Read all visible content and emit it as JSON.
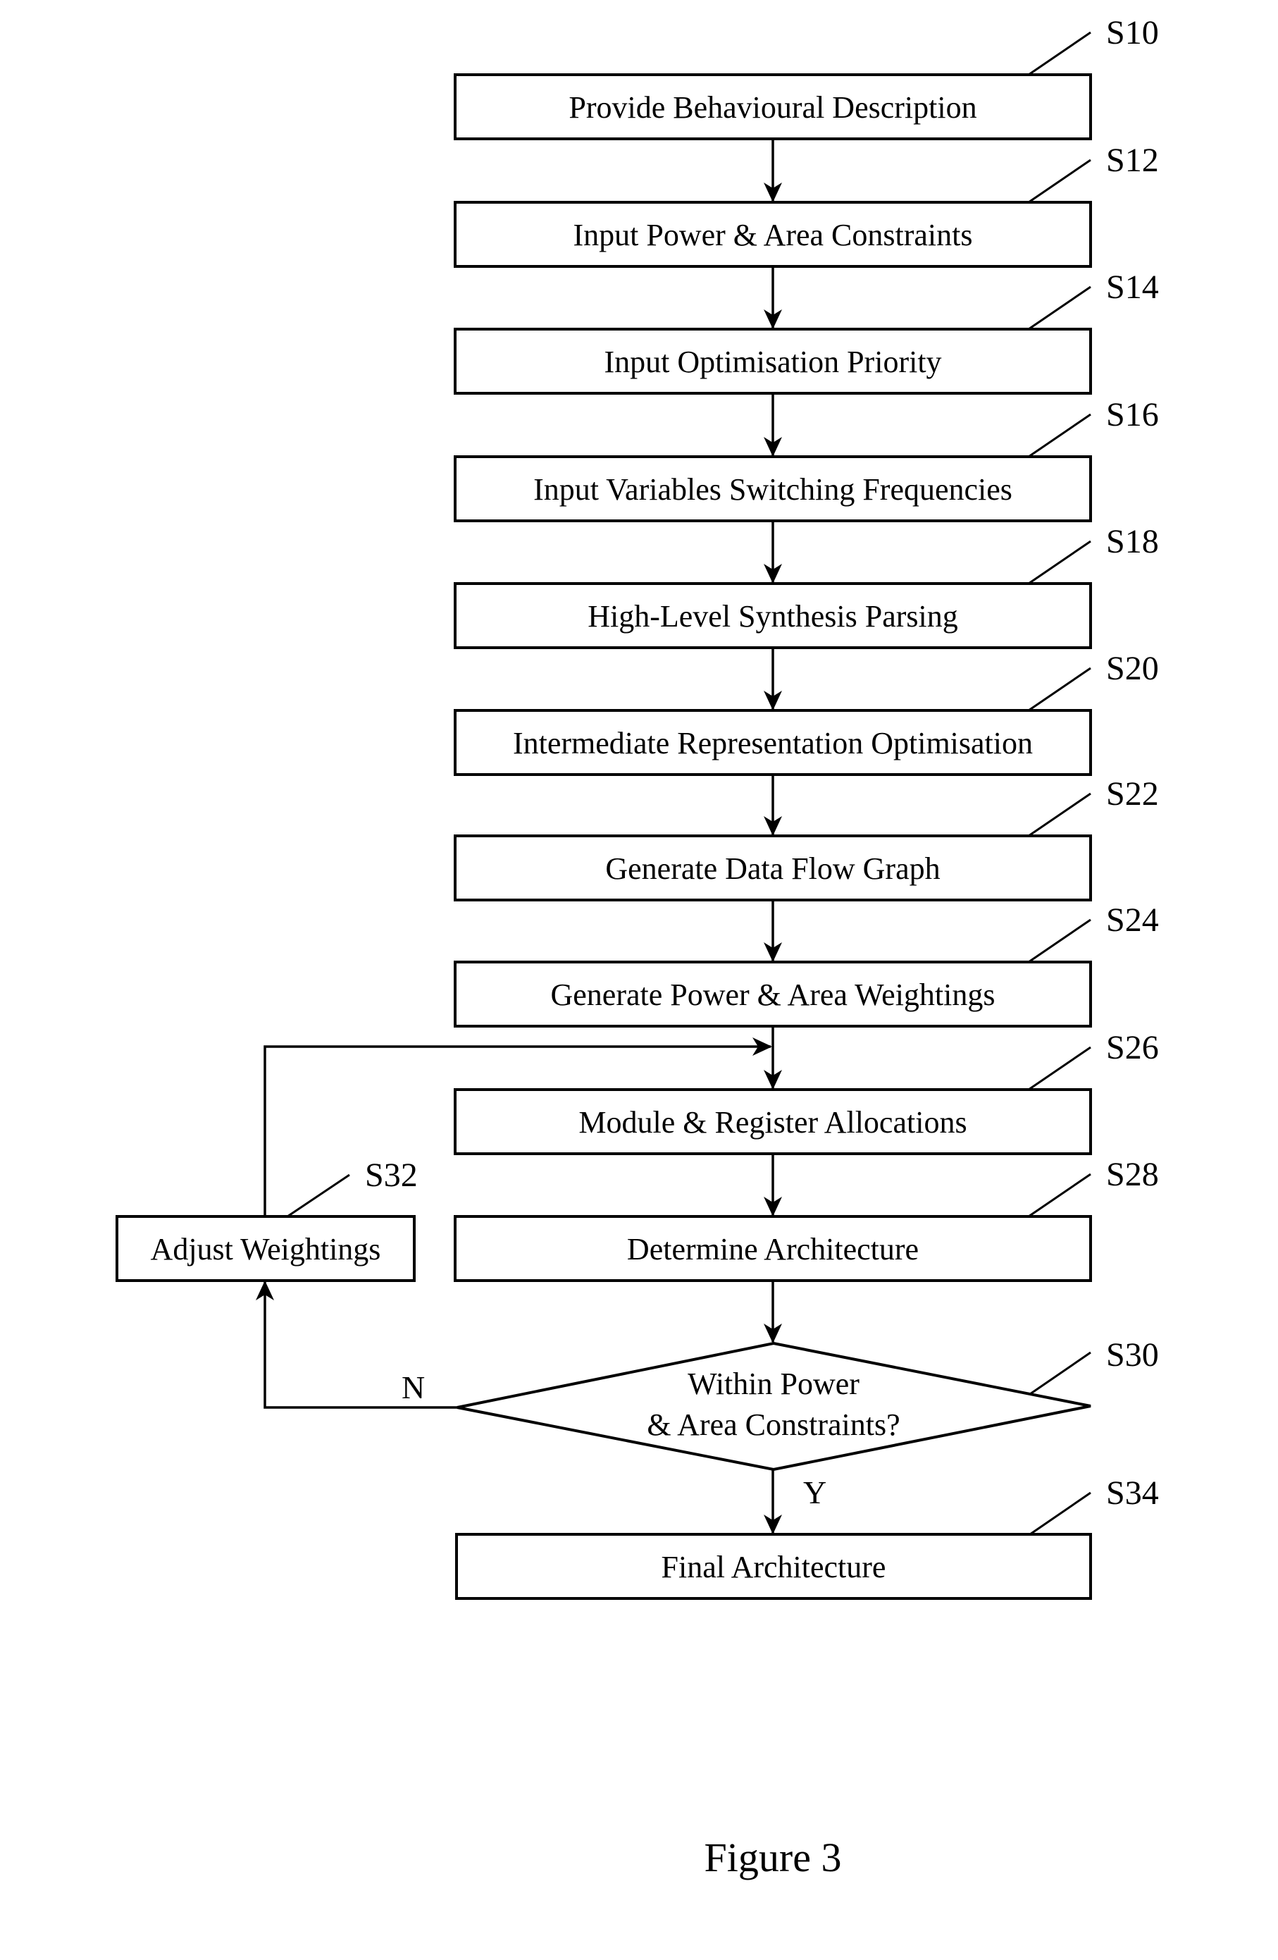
{
  "figure": {
    "caption": "Figure 3",
    "steps": [
      {
        "ref": "S10",
        "label": "Provide Behavioural Description"
      },
      {
        "ref": "S12",
        "label": "Input Power & Area Constraints"
      },
      {
        "ref": "S14",
        "label": "Input Optimisation Priority"
      },
      {
        "ref": "S16",
        "label": "Input Variables Switching Frequencies"
      },
      {
        "ref": "S18",
        "label": "High-Level Synthesis Parsing"
      },
      {
        "ref": "S20",
        "label": "Intermediate Representation Optimisation"
      },
      {
        "ref": "S22",
        "label": "Generate Data Flow Graph"
      },
      {
        "ref": "S24",
        "label": "Generate Power & Area Weightings"
      },
      {
        "ref": "S26",
        "label": "Module & Register Allocations"
      },
      {
        "ref": "S28",
        "label": "Determine Architecture"
      }
    ],
    "decision": {
      "ref": "S30",
      "line1": "Within Power",
      "line2": "& Area Constraints?",
      "no_label": "N",
      "yes_label": "Y"
    },
    "adjust": {
      "ref": "S32",
      "label": "Adjust Weightings"
    },
    "final": {
      "ref": "S34",
      "label": "Final Architecture"
    }
  }
}
